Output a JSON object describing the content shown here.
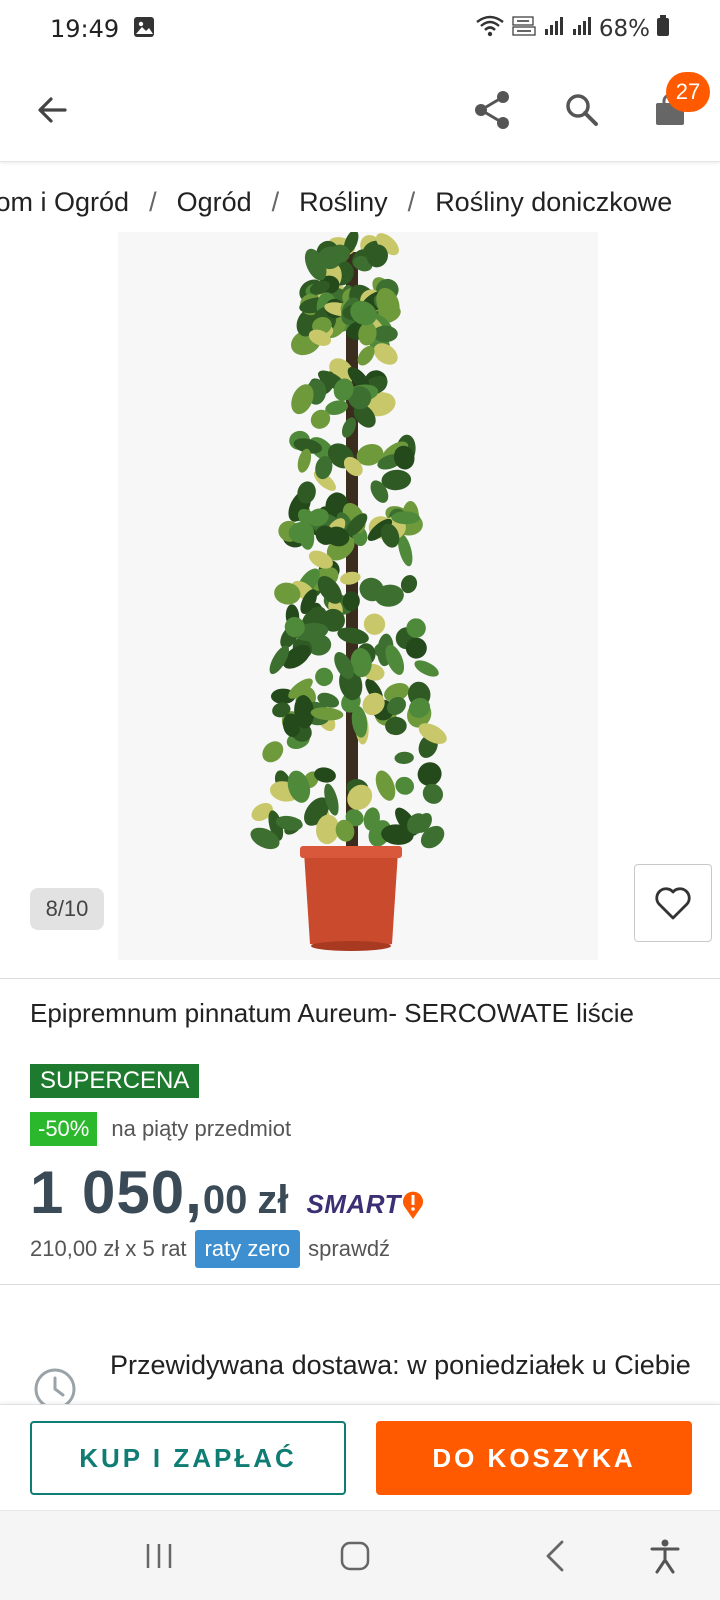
{
  "status_bar": {
    "time": "19:49",
    "battery": "68%",
    "icons": [
      "gallery-icon",
      "wifi-icon",
      "volte-icon",
      "signal-icon",
      "signal-icon",
      "battery-icon"
    ]
  },
  "app_bar": {
    "icons": [
      "back-arrow-icon",
      "share-icon",
      "search-icon",
      "cart-icon"
    ],
    "cart_count": "27"
  },
  "breadcrumb": {
    "items": [
      "Dom i Ogród",
      "Ogród",
      "Rośliny",
      "Rośliny doniczkowe"
    ],
    "separator": "/"
  },
  "gallery": {
    "counter": "8/10"
  },
  "product": {
    "title": "Epipremnum pinnatum Aureum- SERCOWATE liście",
    "badge": "SUPERCENA",
    "discount": "-50%",
    "discount_text": "na piąty przedmiot",
    "price_main": "1 050,",
    "price_decimals": "00",
    "price_currency": "zł",
    "smart_label": "SMART",
    "installment_text": "210,00 zł x 5 rat",
    "raty_label": "raty zero",
    "check_label": "sprawdź"
  },
  "delivery": {
    "text": "Przewidywana dostawa: w poniedziałek u Ciebie"
  },
  "actions": {
    "buy_label": "KUP I ZAPŁAĆ",
    "cart_label": "DO KOSZYKA"
  },
  "colors": {
    "accent": "#ff5a00",
    "buy_outline": "#0f7d74",
    "supercena": "#1e7a2e",
    "discount": "#2cb82c",
    "raty": "#3d8fcf",
    "price": "#3a4a56"
  },
  "nav_bar": {
    "icons": [
      "recents-icon",
      "home-icon",
      "back-icon",
      "accessibility-icon"
    ]
  }
}
